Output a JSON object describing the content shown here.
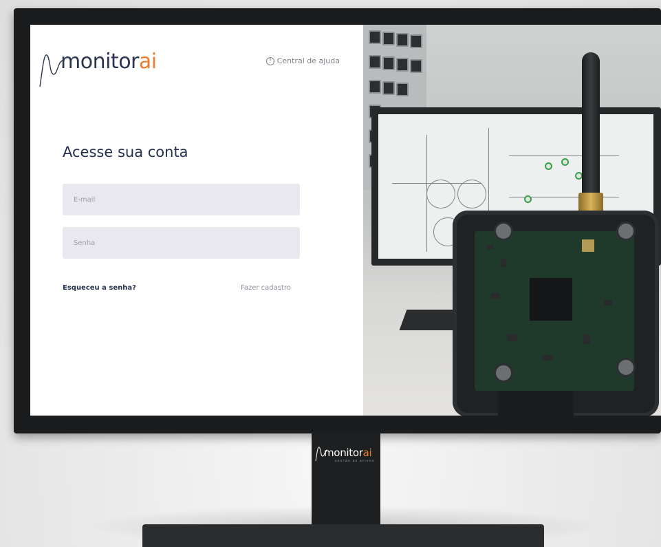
{
  "brand": {
    "prefix": "monitor",
    "suffix": "ai",
    "accent_color": "#ee7d2f",
    "text_color": "#2a3550"
  },
  "header": {
    "help_label": "Central de ajuda",
    "help_icon": "question-circle-icon"
  },
  "login": {
    "title": "Acesse sua conta",
    "email_placeholder": "E-mail",
    "password_placeholder": "Senha",
    "forgot_label": "Esqueceu a senha?",
    "signup_label": "Fazer cadastro"
  },
  "stand_logo": {
    "prefix": "monitor",
    "suffix": "ai",
    "tagline": "GESTÃO DE ATIVOS"
  }
}
